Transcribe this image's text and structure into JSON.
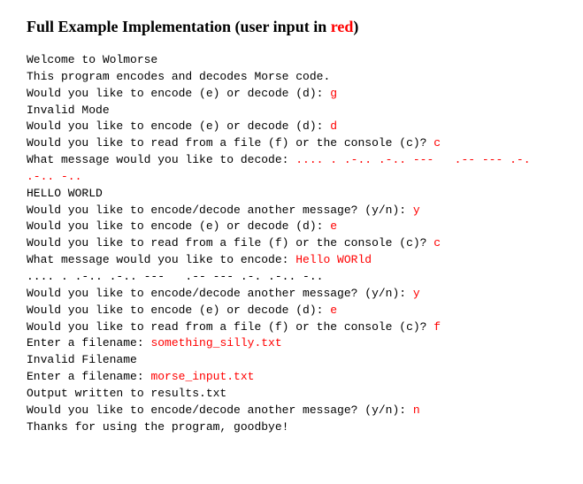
{
  "heading_prefix": "Full Example Implementation (user input in ",
  "heading_red": "red",
  "heading_suffix": ")",
  "lines": [
    {
      "prompt": "Welcome to Wolmorse",
      "input": ""
    },
    {
      "prompt": "This program encodes and decodes Morse code.",
      "input": ""
    },
    {
      "prompt": "Would you like to encode (e) or decode (d): ",
      "input": "g"
    },
    {
      "prompt": "Invalid Mode",
      "input": ""
    },
    {
      "prompt": "Would you like to encode (e) or decode (d): ",
      "input": "d"
    },
    {
      "prompt": "Would you like to read from a file (f) or the console (c)? ",
      "input": "c"
    },
    {
      "prompt": "What message would you like to decode: ",
      "input": ".... . .-.. .-.. ---   .-- --- .-. .-.. -.."
    },
    {
      "prompt": "HELLO WORLD",
      "input": ""
    },
    {
      "prompt": "Would you like to encode/decode another message? (y/n): ",
      "input": "y"
    },
    {
      "prompt": "Would you like to encode (e) or decode (d): ",
      "input": "e"
    },
    {
      "prompt": "Would you like to read from a file (f) or the console (c)? ",
      "input": "c"
    },
    {
      "prompt": "What message would you like to encode: ",
      "input": "Hello WORld"
    },
    {
      "prompt": ".... . .-.. .-.. ---   .-- --- .-. .-.. -..",
      "input": ""
    },
    {
      "prompt": "Would you like to encode/decode another message? (y/n): ",
      "input": "y"
    },
    {
      "prompt": "Would you like to encode (e) or decode (d): ",
      "input": "e"
    },
    {
      "prompt": "Would you like to read from a file (f) or the console (c)? ",
      "input": "f"
    },
    {
      "prompt": "Enter a filename: ",
      "input": "something_silly.txt"
    },
    {
      "prompt": "Invalid Filename",
      "input": ""
    },
    {
      "prompt": "Enter a filename: ",
      "input": "morse_input.txt"
    },
    {
      "prompt": "Output written to results.txt",
      "input": ""
    },
    {
      "prompt": "Would you like to encode/decode another message? (y/n): ",
      "input": "n"
    },
    {
      "prompt": "Thanks for using the program, goodbye!",
      "input": ""
    }
  ]
}
